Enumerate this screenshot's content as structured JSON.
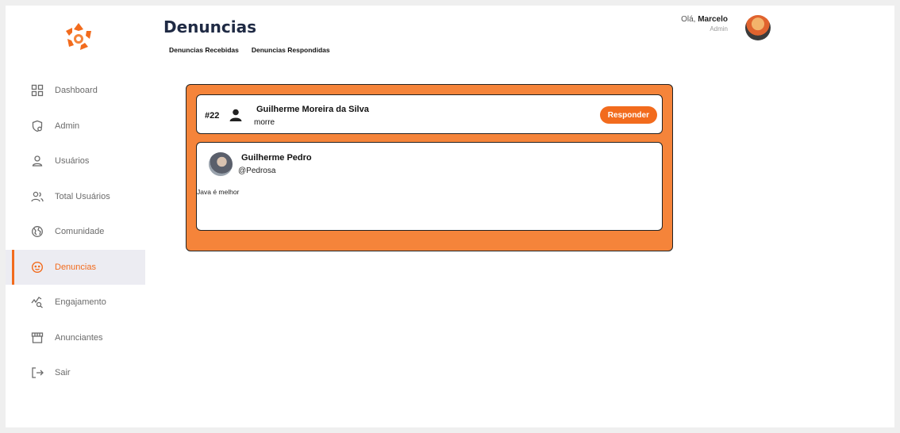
{
  "header": {
    "title": "Denuncias",
    "tabs": [
      "Denuncias Recebidas",
      "Denuncias Respondidas"
    ]
  },
  "user": {
    "greeting": "Olá,",
    "name": "Marcelo",
    "role": "Admin"
  },
  "sidebar": {
    "items": [
      {
        "label": "Dashboard",
        "icon": "grid-icon"
      },
      {
        "label": "Admin",
        "icon": "admin-shield-icon"
      },
      {
        "label": "Usuários",
        "icon": "user-icon"
      },
      {
        "label": "Total Usuários",
        "icon": "users-icon"
      },
      {
        "label": "Comunidade",
        "icon": "globe-icon"
      },
      {
        "label": "Denuncias",
        "icon": "face-icon",
        "active": true
      },
      {
        "label": "Engajamento",
        "icon": "engagement-icon"
      },
      {
        "label": "Anunciantes",
        "icon": "store-icon"
      },
      {
        "label": "Sair",
        "icon": "logout-icon"
      }
    ]
  },
  "report": {
    "id": "#22",
    "reported_by": "Guilherme Moreira da Silva",
    "reason": "morre",
    "respond_label": "Responder"
  },
  "post": {
    "author": "Guilherme Pedro",
    "handle": "@Pedrosa",
    "text": "Java é melhor"
  },
  "colors": {
    "accent": "#f26b1d",
    "panel": "#f5843a",
    "title": "#1f2a44"
  }
}
